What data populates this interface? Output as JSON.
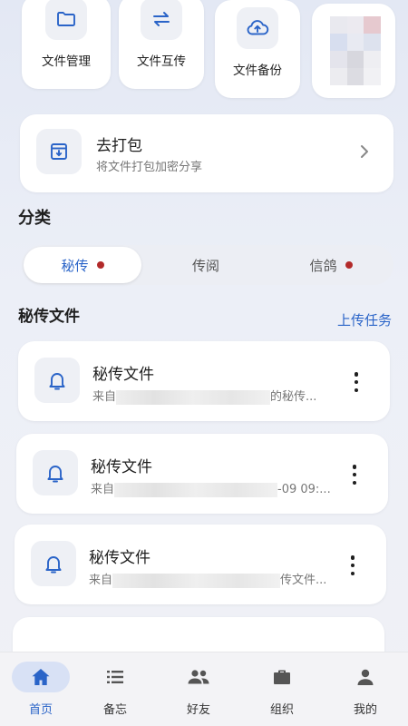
{
  "quick_actions": [
    {
      "label": "文件管理",
      "icon": "folder-icon"
    },
    {
      "label": "文件互传",
      "icon": "transfer-icon"
    },
    {
      "label": "文件备份",
      "icon": "cloud-upload-icon"
    }
  ],
  "pack": {
    "title": "去打包",
    "subtitle": "将文件打包加密分享",
    "icon": "archive-box-icon"
  },
  "category": {
    "title": "分类",
    "tabs": [
      {
        "label": "秘传",
        "active": true,
        "dot": true
      },
      {
        "label": "传阅",
        "active": false,
        "dot": false
      },
      {
        "label": "信鸽",
        "active": false,
        "dot": true
      }
    ]
  },
  "list": {
    "title": "秘传文件",
    "action": "上传任务",
    "items": [
      {
        "title": "秘传文件",
        "sub_prefix": "来自",
        "sub_suffix": "的秘传..."
      },
      {
        "title": "秘传文件",
        "sub_prefix": "来自",
        "sub_suffix": "-09 09:..."
      },
      {
        "title": "秘传文件",
        "sub_prefix": "来自",
        "sub_suffix": "传文件..."
      }
    ]
  },
  "tabbar": [
    {
      "label": "首页",
      "icon": "home-icon",
      "active": true
    },
    {
      "label": "备忘",
      "icon": "list-icon",
      "active": false
    },
    {
      "label": "好友",
      "icon": "friends-icon",
      "active": false
    },
    {
      "label": "组织",
      "icon": "briefcase-icon",
      "active": false
    },
    {
      "label": "我的",
      "icon": "person-icon",
      "active": false
    }
  ],
  "colors": {
    "accent": "#2a64c8",
    "badge": "#b22a2a",
    "card": "#ffffff"
  }
}
